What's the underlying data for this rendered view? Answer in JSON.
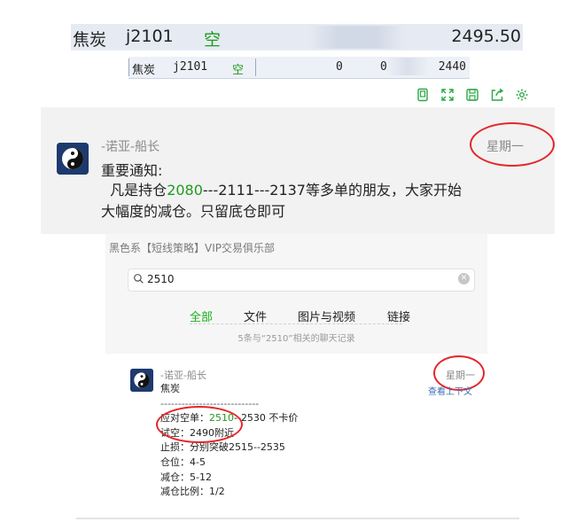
{
  "quote_big": {
    "name": "焦炭",
    "code": "j2101",
    "side": "空",
    "price": "2495.50"
  },
  "quote_small": {
    "name": "焦炭",
    "code": "j2101",
    "side": "空",
    "v1": "0",
    "v2": "0",
    "price": "2440"
  },
  "tools": [
    "restore-icon",
    "fullscreen-icon",
    "save-icon",
    "share-icon",
    "settings-icon"
  ],
  "notice": {
    "sender": "-诺亚-船长",
    "day": "星期一",
    "title": "重要通知:",
    "body_pre": "凡是持仓",
    "body_highlight": "2080",
    "body_post": "---2111---2137等多单的朋友，大家开始大幅度的减仓。只留底仓即可"
  },
  "panel": {
    "group_name": "黑色系【短线策略】VIP交易俱乐部",
    "search_query": "2510",
    "tabs": [
      "全部",
      "文件",
      "图片与视频",
      "链接"
    ],
    "result_count": "5条与“2510”相关的聊天记录",
    "result": {
      "sender": "-诺亚-船长",
      "day": "星期一",
      "context_link": "查看上下文",
      "topic": "焦炭",
      "divider": "----------------------------",
      "l1_label": "应对空单：",
      "l1_highlight": "2510",
      "l1_rest": "--2530  不卡价",
      "l2": "试空：2490附近",
      "l3": "止损：分别突破2515--2535",
      "l4": "仓位：4-5",
      "l5": "减仓：5-12",
      "l6": "减仓比例：1/2"
    }
  },
  "colors": {
    "accent_green": "#1aad19",
    "mark_red": "#e5262b",
    "link_blue": "#3a6fb4"
  }
}
